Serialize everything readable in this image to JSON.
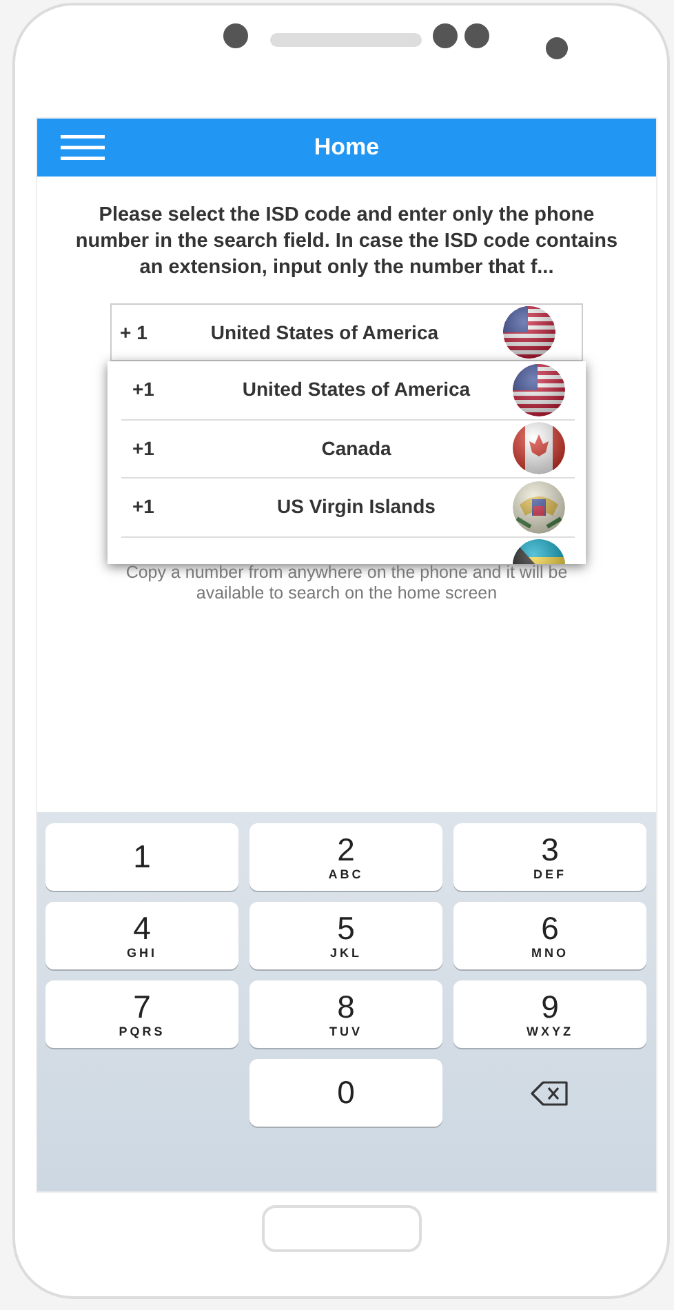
{
  "app_bar": {
    "title": "Home"
  },
  "instructions": "Please select the ISD code and enter only the phone number in the search field. In case the ISD code contains an extension, input only the number that f...",
  "country_select": {
    "code": "+ 1",
    "country": "United States of America",
    "kind": "us"
  },
  "dropdown": [
    {
      "code": "+1",
      "country": "United States of America",
      "kind": "us"
    },
    {
      "code": "+1",
      "country": "Canada",
      "kind": "ca"
    },
    {
      "code": "+1",
      "country": "US Virgin Islands",
      "kind": "vi"
    },
    {
      "kind": "bs"
    }
  ],
  "hint": "Copy a number from anywhere on the phone and it will be available to search on the home screen",
  "keypad": [
    {
      "kind": "digit",
      "digit": "1"
    },
    {
      "kind": "digit",
      "digit": "2",
      "letters": "ABC"
    },
    {
      "kind": "digit",
      "digit": "3",
      "letters": "DEF"
    },
    {
      "kind": "digit",
      "digit": "4",
      "letters": "GHI"
    },
    {
      "kind": "digit",
      "digit": "5",
      "letters": "JKL"
    },
    {
      "kind": "digit",
      "digit": "6",
      "letters": "MNO"
    },
    {
      "kind": "digit",
      "digit": "7",
      "letters": "PQRS"
    },
    {
      "kind": "digit",
      "digit": "8",
      "letters": "TUV"
    },
    {
      "kind": "digit",
      "digit": "9",
      "letters": "WXYZ"
    },
    {
      "kind": "blank"
    },
    {
      "kind": "digit",
      "digit": "0"
    },
    {
      "kind": "backspace"
    }
  ]
}
